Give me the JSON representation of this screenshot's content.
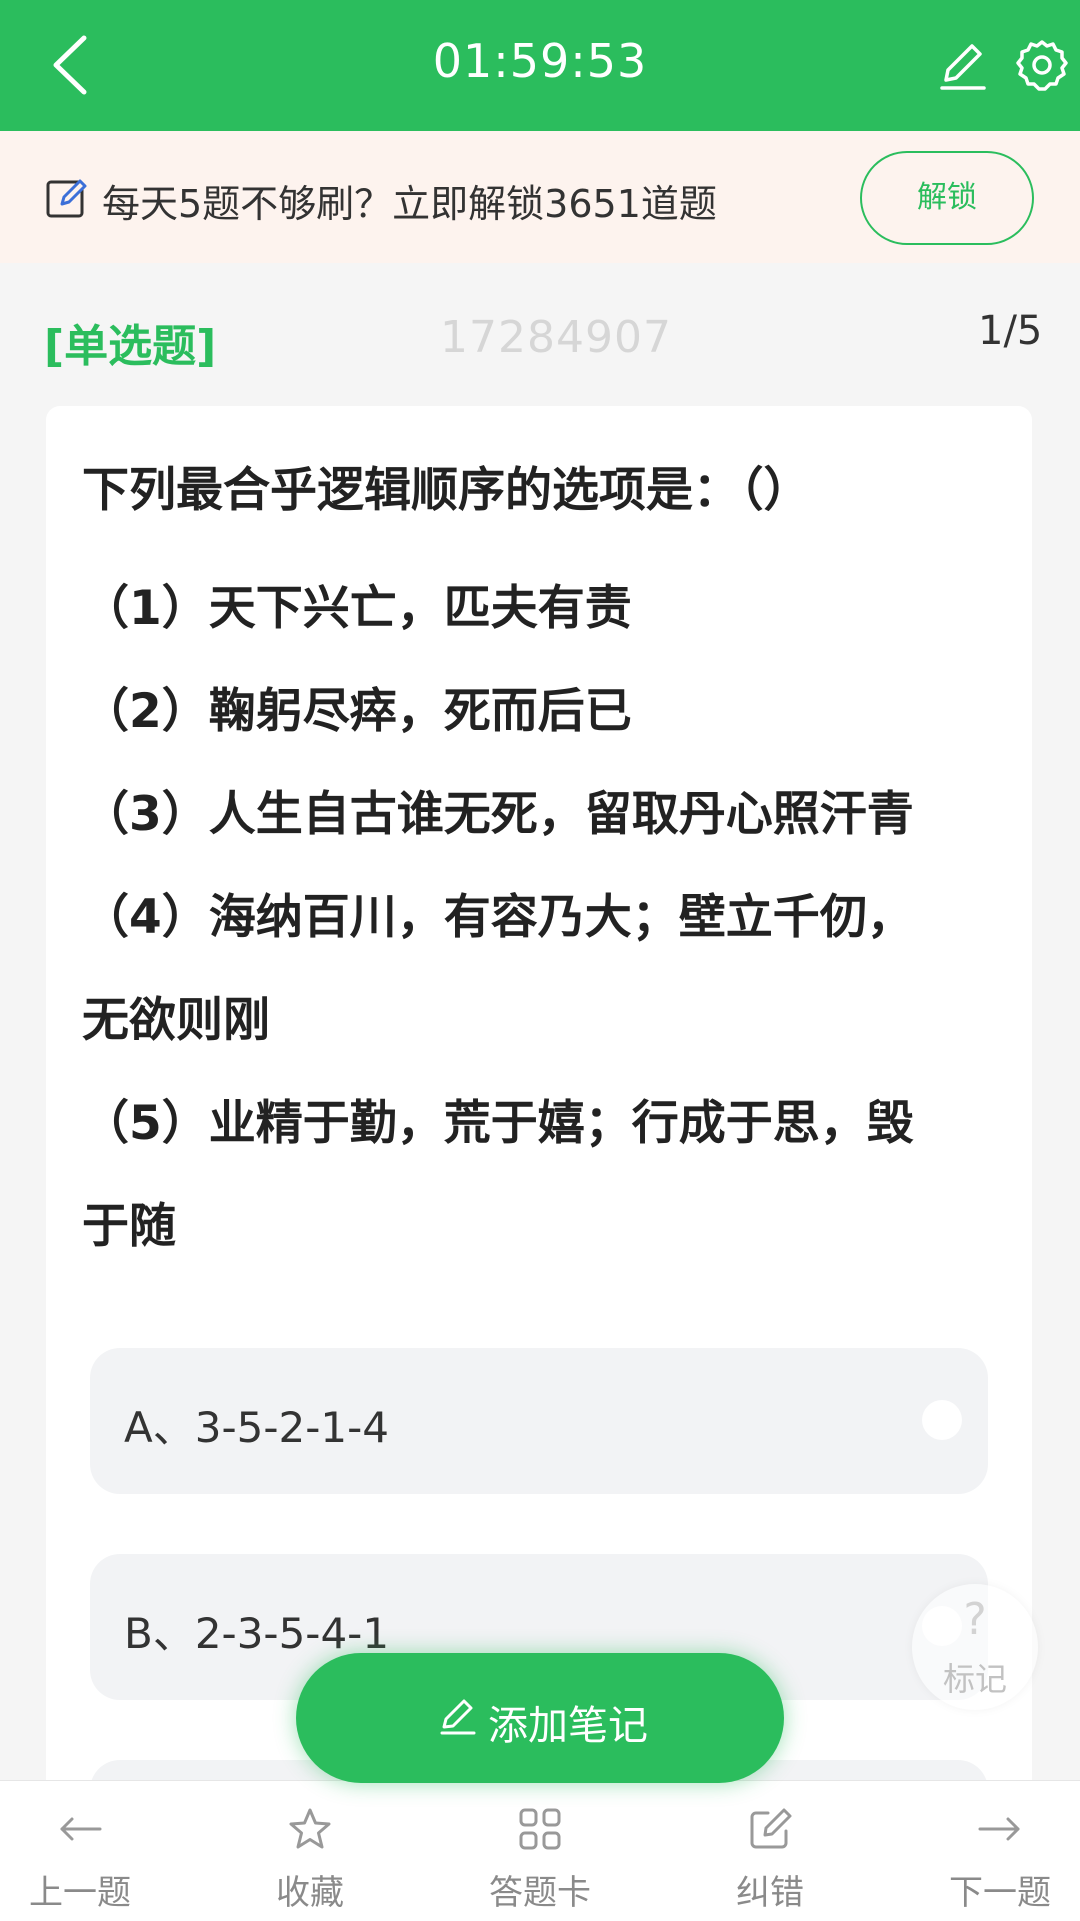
{
  "header": {
    "timer": "01:59:53",
    "color": "#2bbd5d"
  },
  "banner": {
    "text": "每天5题不够刷？立即解锁3651道题",
    "unlock_label": "解锁"
  },
  "question": {
    "type_label": "[单选题]",
    "id": "17284907",
    "position": "1/5",
    "stem_lines": [
      "下列最合乎逻辑顺序的选项是：（）",
      "（1）天下兴亡，匹夫有责",
      "（2）鞠躬尽瘁，死而后已",
      "（3）人生自古谁无死，留取丹心照汗青",
      "（4）海纳百川，有容乃大；壁立千仞，",
      "无欲则刚",
      "（5）业精于勤，荒于嬉；行成于思，毁",
      "于随"
    ],
    "options": [
      {
        "label": "A、3-5-2-1-4"
      },
      {
        "label": "B、2-3-5-4-1"
      },
      {
        "label": ""
      }
    ]
  },
  "mark": {
    "symbol": "?",
    "label": "标记"
  },
  "add_note": {
    "label": "添加笔记"
  },
  "bottom_nav": {
    "prev": "上一题",
    "favorite": "收藏",
    "answer_card": "答题卡",
    "report_error": "纠错",
    "next": "下一题"
  }
}
